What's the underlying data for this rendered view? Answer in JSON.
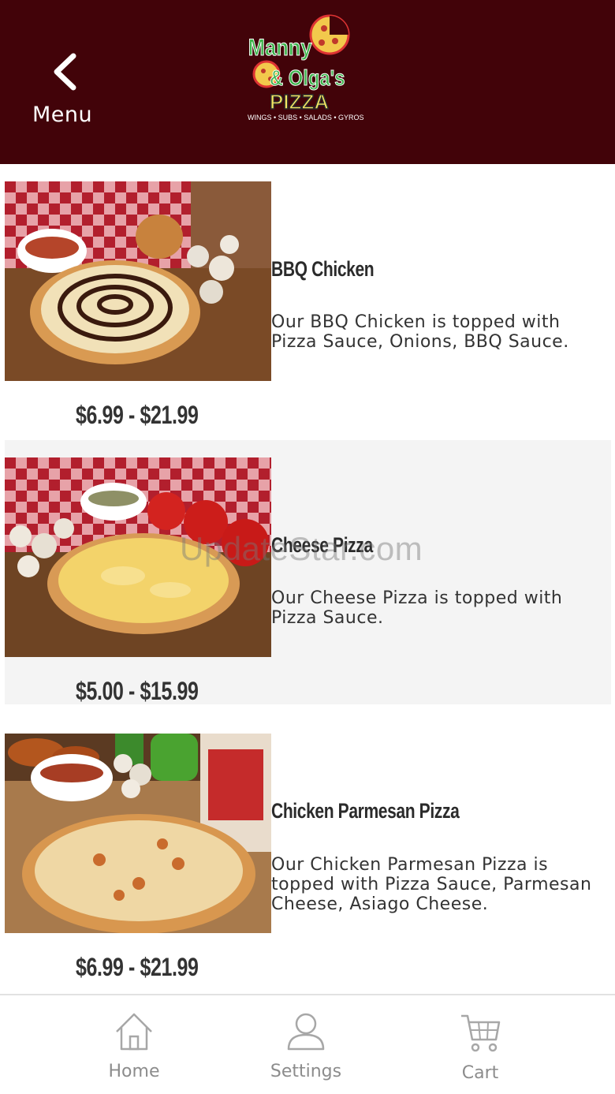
{
  "header": {
    "back_label": "Menu",
    "background": "#420309",
    "logo": {
      "line1": "Manny",
      "line2": "& Olga's",
      "line3": "PIZZA",
      "tagline": "WINGS • SUBS • SALADS • GYROS"
    }
  },
  "items": [
    {
      "name": "BBQ Chicken",
      "description": "Our BBQ Chicken is topped with Pizza Sauce, Onions, BBQ Sauce.",
      "price": "$6.99 - $21.99"
    },
    {
      "name": "Cheese Pizza",
      "description": "Our Cheese Pizza is topped with Pizza Sauce.",
      "price": "$5.00 - $15.99"
    },
    {
      "name": "Chicken Parmesan Pizza",
      "description": "Our Chicken Parmesan Pizza is topped with Pizza Sauce, Parmesan Cheese, Asiago Cheese.",
      "price": "$6.99 - $21.99"
    }
  ],
  "watermark": "UpdateStar.com",
  "tabs": [
    {
      "label": "Home",
      "icon": "home-icon"
    },
    {
      "label": "Settings",
      "icon": "user-icon"
    },
    {
      "label": "Cart",
      "icon": "cart-icon"
    }
  ]
}
